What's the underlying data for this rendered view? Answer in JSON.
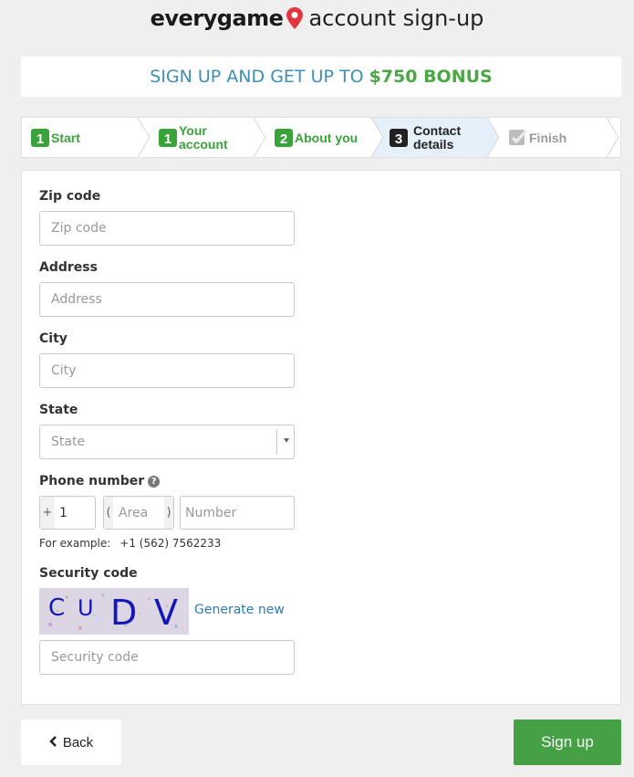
{
  "header": {
    "brand": "everygame",
    "title": "account sign-up"
  },
  "banner": {
    "prefix": "SIGN UP AND GET UP TO ",
    "amount": "$750 BONUS"
  },
  "steps": [
    {
      "num": "1",
      "label": "Start",
      "status": "done"
    },
    {
      "num": "1",
      "label": "Your account",
      "status": "done"
    },
    {
      "num": "2",
      "label": "About you",
      "status": "done"
    },
    {
      "num": "3",
      "label": "Contact details",
      "status": "current"
    },
    {
      "num": "",
      "label": "Finish",
      "status": "pending"
    }
  ],
  "form": {
    "zip": {
      "label": "Zip code",
      "placeholder": "Zip code"
    },
    "address": {
      "label": "Address",
      "placeholder": "Address"
    },
    "city": {
      "label": "City",
      "placeholder": "City"
    },
    "state": {
      "label": "State",
      "value": "State"
    },
    "phone": {
      "label": "Phone number",
      "plus": "+",
      "country_code": "1",
      "area_open": "(",
      "area_close": ")",
      "area_placeholder": "Area",
      "number_placeholder": "Number",
      "example_label": "For example:",
      "example_value": "+1 (562) 7562233"
    },
    "security": {
      "label": "Security code",
      "captcha_text": "CUDV",
      "generate_label": "Generate new",
      "placeholder": "Security code"
    }
  },
  "buttons": {
    "back": "Back",
    "signup": "Sign up"
  },
  "colors": {
    "green": "#46a046",
    "blue": "#3c8fb8",
    "brand_red": "#e2353f"
  }
}
